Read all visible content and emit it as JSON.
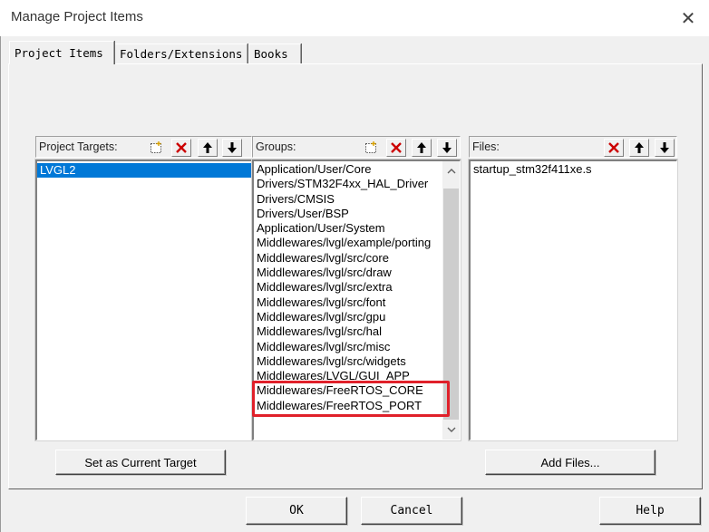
{
  "window": {
    "title": "Manage Project Items"
  },
  "tabs": [
    {
      "label": "Project Items",
      "active": true
    },
    {
      "label": "Folders/Extensions",
      "active": false
    },
    {
      "label": "Books",
      "active": false
    }
  ],
  "targets": {
    "label": "Project Targets:",
    "items": [
      "LVGL2"
    ],
    "selected": "LVGL2",
    "toolbar": [
      "new-icon",
      "delete-icon",
      "move-up-icon",
      "move-down-icon"
    ]
  },
  "groups": {
    "label": "Groups:",
    "items": [
      "Application/User/Core",
      "Drivers/STM32F4xx_HAL_Driver",
      "Drivers/CMSIS",
      "Drivers/User/BSP",
      "Application/User/System",
      "Middlewares/lvgl/example/porting",
      "Middlewares/lvgl/src/core",
      "Middlewares/lvgl/src/draw",
      "Middlewares/lvgl/src/extra",
      "Middlewares/lvgl/src/font",
      "Middlewares/lvgl/src/gpu",
      "Middlewares/lvgl/src/hal",
      "Middlewares/lvgl/src/misc",
      "Middlewares/lvgl/src/widgets",
      "Middlewares/LVGL/GUI_APP",
      "Middlewares/FreeRTOS_CORE",
      "Middlewares/FreeRTOS_PORT"
    ],
    "highlighted": [
      "Middlewares/FreeRTOS_CORE",
      "Middlewares/FreeRTOS_PORT"
    ],
    "highlight_color": "#e0202a",
    "toolbar": [
      "new-icon",
      "delete-icon",
      "move-up-icon",
      "move-down-icon"
    ]
  },
  "files": {
    "label": "Files:",
    "items": [
      "startup_stm32f411xe.s"
    ],
    "toolbar": [
      "delete-icon",
      "move-up-icon",
      "move-down-icon"
    ]
  },
  "buttons": {
    "set_target": "Set as Current Target",
    "add_files": "Add Files...",
    "ok": "OK",
    "cancel": "Cancel",
    "help": "Help"
  },
  "colors": {
    "selection": "#0078d7",
    "delete": "#cc0000"
  }
}
